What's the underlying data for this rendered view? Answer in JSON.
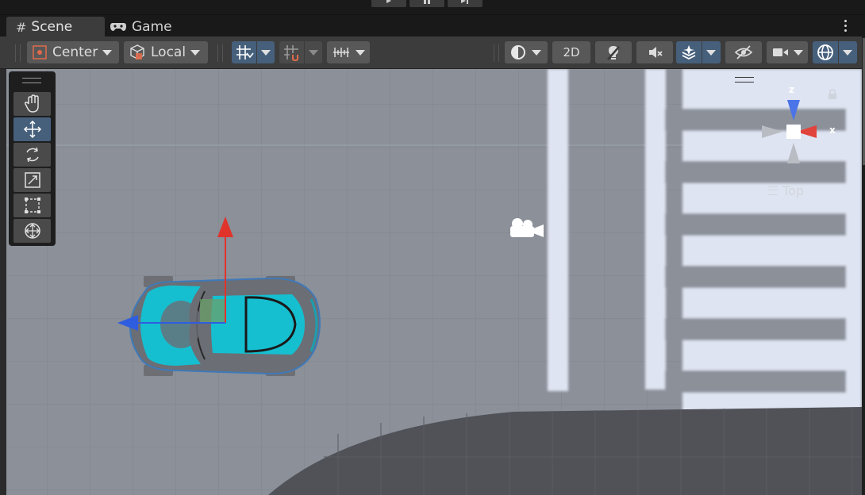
{
  "tabs": [
    {
      "label": "Scene",
      "icon": "grid-hash-icon",
      "active": true
    },
    {
      "label": "Game",
      "icon": "gamepad-icon",
      "active": false
    }
  ],
  "toolbar": {
    "pivot_mode": "Center",
    "pivot_rotation": "Local",
    "mode_2d": "2D"
  },
  "gizmo": {
    "axis_z": "z",
    "axis_x": "x",
    "view_label": "Top"
  },
  "colors": {
    "panel": "#3c3c3c",
    "button": "#585858",
    "button_active": "#46607c",
    "scene_ground": "#8a8f98",
    "axis_x": "#e0332c",
    "axis_y_up": "#d42b2b",
    "axis_z": "#2f5de0",
    "car_body": "#12c0d0"
  }
}
